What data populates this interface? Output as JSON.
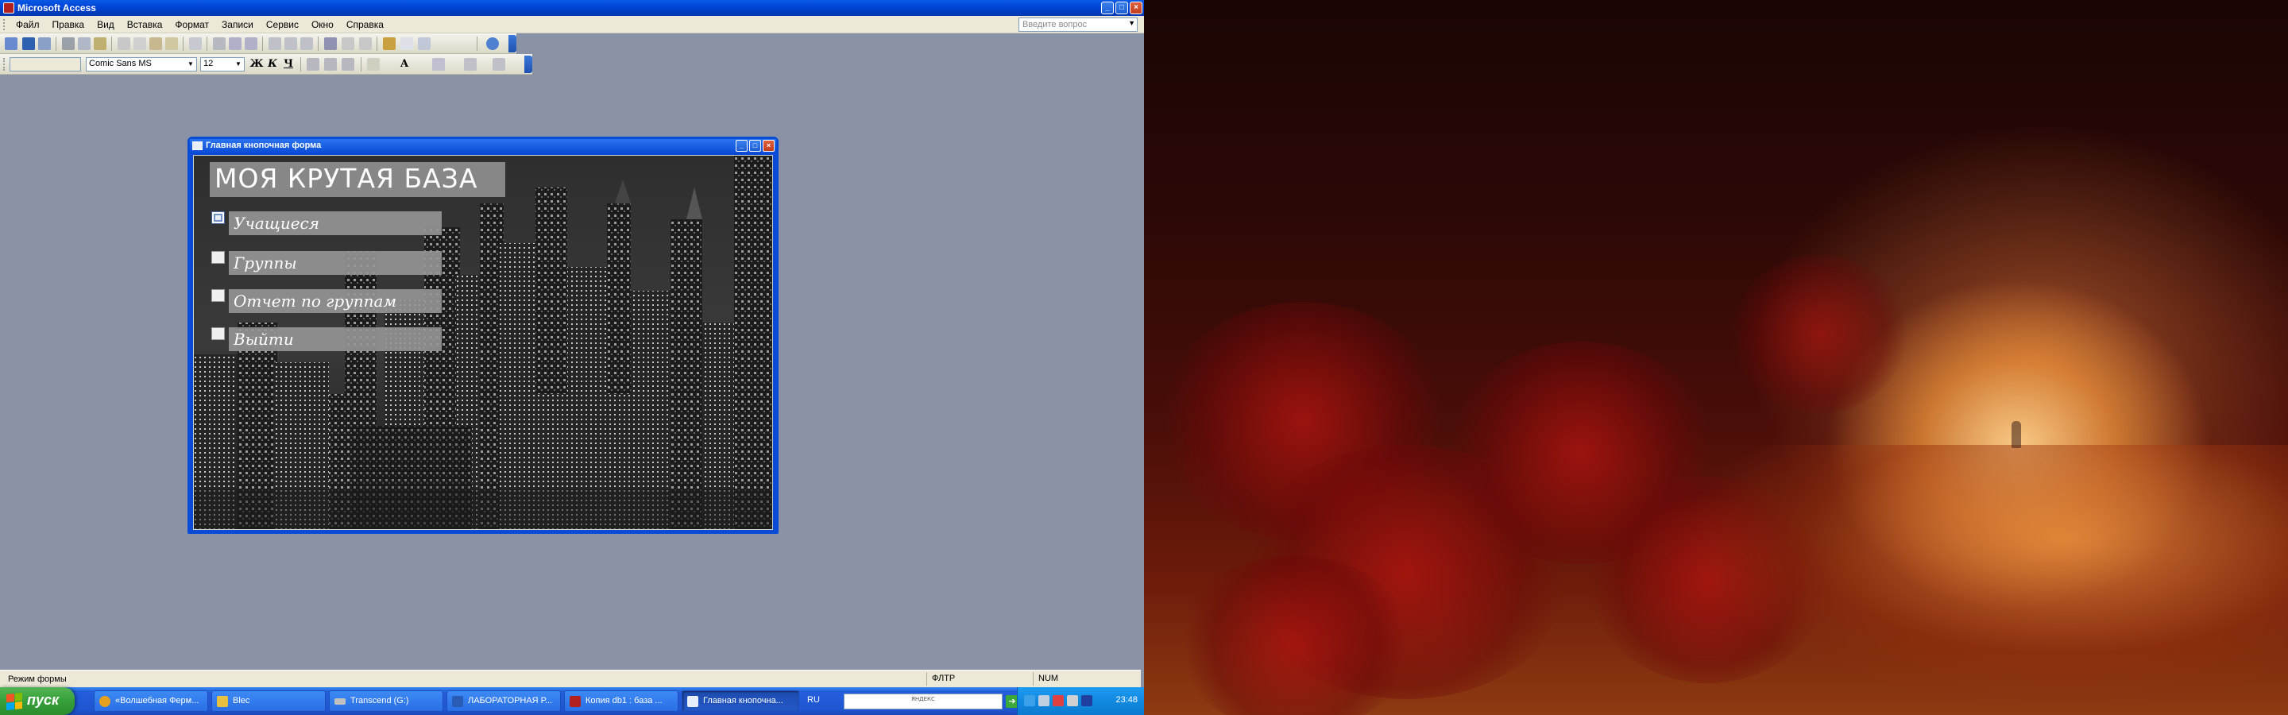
{
  "app": {
    "title": "Microsoft Access",
    "window_buttons": [
      "_",
      "□",
      "×"
    ]
  },
  "menu": {
    "items": [
      "Файл",
      "Правка",
      "Вид",
      "Вставка",
      "Формат",
      "Записи",
      "Сервис",
      "Окно",
      "Справка"
    ],
    "help_placeholder": "Введите вопрос"
  },
  "format_toolbar": {
    "object_combo": "",
    "font": "Comic Sans MS",
    "size": "12",
    "bold": "Ж",
    "italic": "К",
    "underline": "Ч",
    "font_color_label": "A"
  },
  "form": {
    "window_title": "Главная кнопочная форма",
    "db_title": "МОЯ КРУТАЯ БАЗА",
    "items": [
      {
        "label": "Учащиеся"
      },
      {
        "label": "Группы"
      },
      {
        "label": "Отчет по группам"
      },
      {
        "label": "Выйти"
      }
    ]
  },
  "statusbar": {
    "mode": "Режим формы",
    "fltr": "ФЛТР",
    "num": "NUM"
  },
  "taskbar": {
    "start": "пуск",
    "tasks": [
      {
        "label": "«Волшебная Ферм...",
        "icon_color": "#e8a020"
      },
      {
        "label": "Blec",
        "icon_color": "#e8c040"
      },
      {
        "label": "Transcend (G:)",
        "icon_color": "#c0c0c0"
      },
      {
        "label": "ЛАБОРАТОРНАЯ Р...",
        "icon_color": "#2a5bb5"
      },
      {
        "label": "Копия db1 : база ...",
        "icon_color": "#b32020"
      },
      {
        "label": "Главная кнопочна...",
        "icon_color": "#e8eefb"
      }
    ],
    "lang": "RU",
    "search_logo": "ЯНДЕКС",
    "clock": "23:48"
  },
  "colors": {
    "xp_blue": "#0a4bd6",
    "workspace": "#8a93a6",
    "start_green": "#36a03a"
  }
}
